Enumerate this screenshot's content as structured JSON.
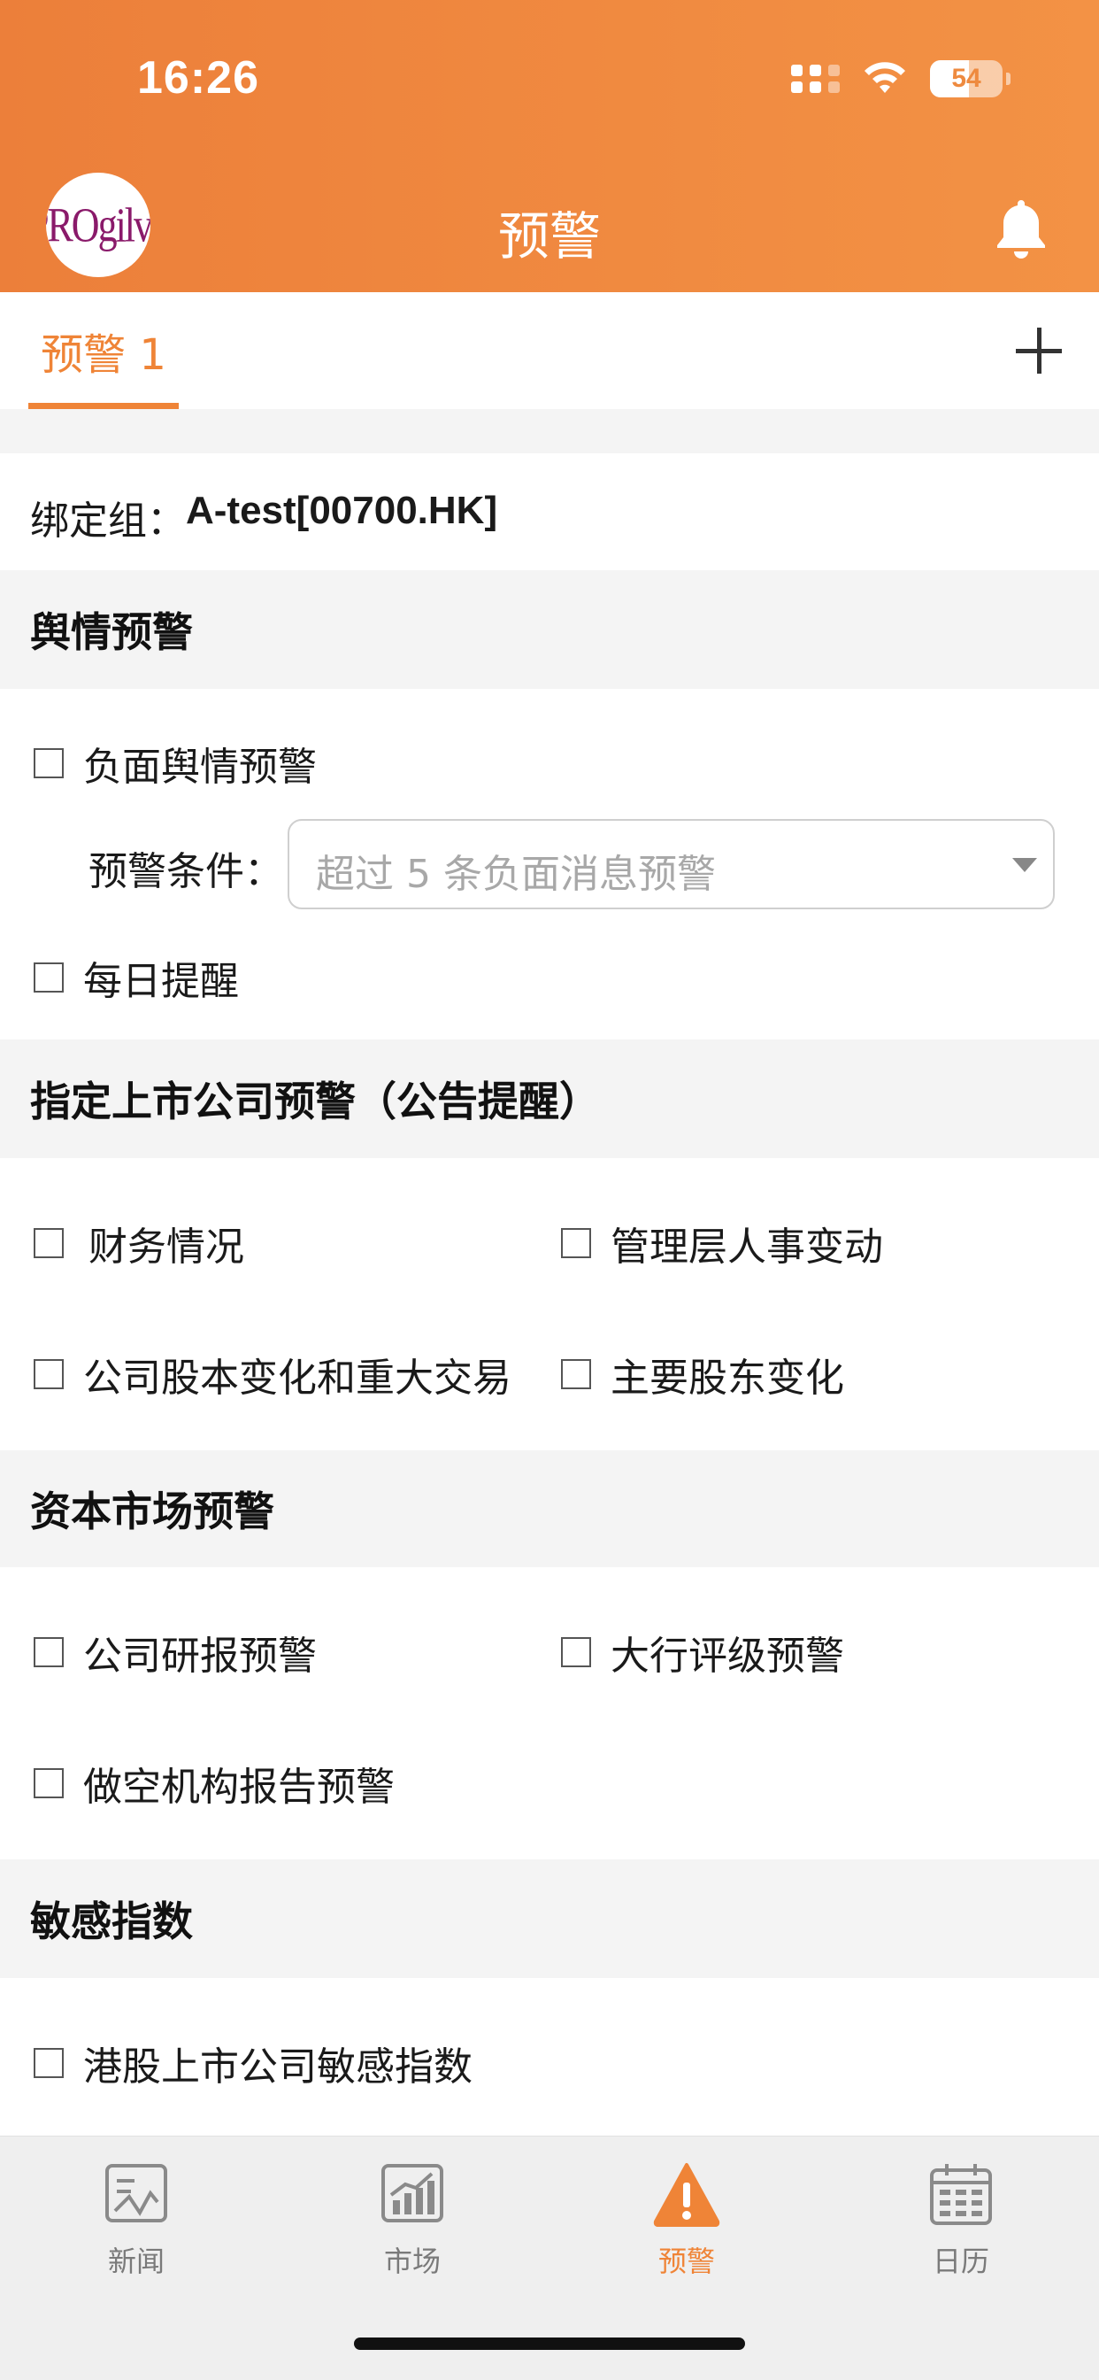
{
  "status_bar": {
    "time": "16:26",
    "battery": "54"
  },
  "header": {
    "logo_text": "PROgilvy",
    "title": "预警"
  },
  "tabs": {
    "items": [
      {
        "label": "预警 1"
      }
    ]
  },
  "binding": {
    "label": "绑定组：",
    "value": "A-test[00700.HK]"
  },
  "sections": {
    "sentiment": {
      "title": "舆情预警",
      "negative": "负面舆情预警",
      "condition_label": "预警条件：",
      "condition_placeholder": "超过 5 条负面消息预警",
      "daily": "每日提醒"
    },
    "listed": {
      "title": "指定上市公司预警（公告提醒）",
      "items": [
        "财务情况",
        "管理层人事变动",
        "公司股本变化和重大交易",
        "主要股东变化"
      ]
    },
    "capital": {
      "title": "资本市场预警",
      "items": [
        "公司研报预警",
        "大行评级预警",
        "做空机构报告预警"
      ]
    },
    "sensitive": {
      "title": "敏感指数",
      "items": [
        "港股上市公司敏感指数"
      ]
    }
  },
  "bottom_nav": {
    "items": [
      {
        "label": "新闻",
        "icon": "news-icon"
      },
      {
        "label": "市场",
        "icon": "market-chart-icon"
      },
      {
        "label": "预警",
        "icon": "warning-icon"
      },
      {
        "label": "日历",
        "icon": "calendar-icon"
      }
    ],
    "active": "预警"
  },
  "colors": {
    "accent": "#ef8437",
    "header_start": "#ec7f3a",
    "header_end": "#f39245",
    "section_bg": "#f4f4f4"
  }
}
